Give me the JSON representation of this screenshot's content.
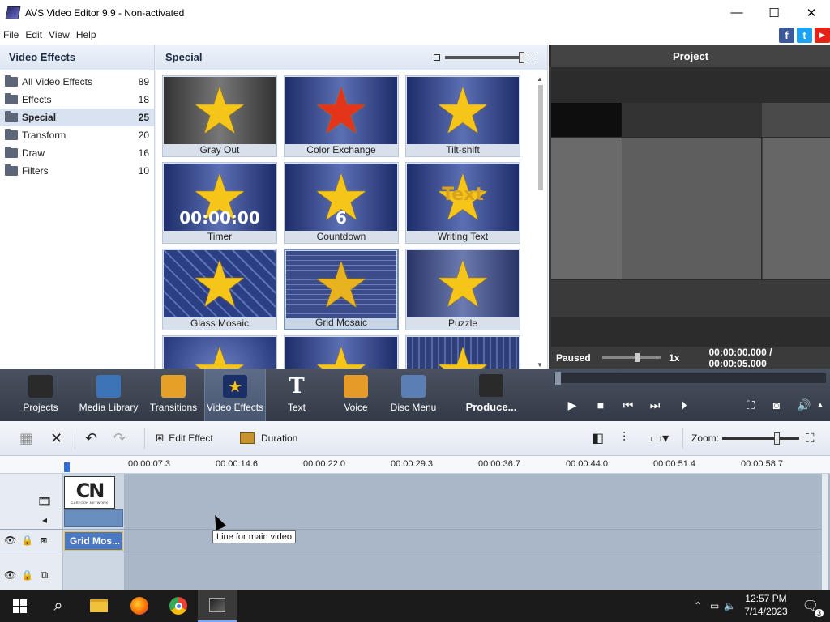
{
  "window": {
    "title": "AVS Video Editor 9.9 - Non-activated",
    "minimize": "—",
    "maximize": "☐",
    "close": "✕"
  },
  "menu": [
    "File",
    "Edit",
    "View",
    "Help"
  ],
  "social": {
    "facebook": "f",
    "twitter": "t",
    "youtube": "▶",
    "colors": {
      "facebook": "#3b5998",
      "twitter": "#1da1f2",
      "youtube": "#e62117"
    }
  },
  "categories": {
    "title": "Video Effects",
    "items": [
      {
        "label": "All Video Effects",
        "count": "89"
      },
      {
        "label": "Effects",
        "count": "18"
      },
      {
        "label": "Special",
        "count": "25",
        "selected": true
      },
      {
        "label": "Transform",
        "count": "20"
      },
      {
        "label": "Draw",
        "count": "16"
      },
      {
        "label": "Filters",
        "count": "10"
      }
    ]
  },
  "gallery": {
    "title": "Special",
    "tiles": [
      {
        "label": "Gray Out",
        "overlay": ""
      },
      {
        "label": "Color Exchange",
        "overlay": ""
      },
      {
        "label": "Tilt-shift",
        "overlay": ""
      },
      {
        "label": "Timer",
        "overlay": "00:00:00"
      },
      {
        "label": "Countdown",
        "overlay": "6"
      },
      {
        "label": "Writing Text",
        "overlay": "Text"
      },
      {
        "label": "Glass Mosaic",
        "overlay": ""
      },
      {
        "label": "Grid Mosaic",
        "overlay": "",
        "selected": true
      },
      {
        "label": "Puzzle",
        "overlay": ""
      },
      {
        "label": "",
        "overlay": ""
      },
      {
        "label": "",
        "overlay": ""
      },
      {
        "label": "",
        "overlay": ""
      }
    ]
  },
  "preview": {
    "title": "Project",
    "status": "Paused",
    "speed": "1x",
    "time": "00:00:00.000 / 00:00:05.000"
  },
  "toolbar": {
    "items": [
      {
        "label": "Projects",
        "icon": "clapper-icon"
      },
      {
        "label": "Media Library",
        "icon": "film-icon"
      },
      {
        "label": "Transitions",
        "icon": "transitions-icon"
      },
      {
        "label": "Video Effects",
        "icon": "star-icon",
        "active": true
      },
      {
        "label": "Text",
        "icon": "text-icon",
        "glyph": "T"
      },
      {
        "label": "Voice",
        "icon": "microphone-icon"
      },
      {
        "label": "Disc Menu",
        "icon": "disc-icon"
      },
      {
        "label": "Produce...",
        "icon": "produce-icon"
      }
    ]
  },
  "timeline_toolbar": {
    "edit_effect": "Edit Effect",
    "duration": "Duration",
    "zoom_label": "Zoom:"
  },
  "ruler": {
    "ticks": [
      "00:00:07.3",
      "00:00:14.6",
      "00:00:22.0",
      "00:00:29.3",
      "00:00:36.7",
      "00:00:44.0",
      "00:00:51.4",
      "00:00:58.7"
    ]
  },
  "tracks": {
    "video_clip_text": "CN",
    "video_clip_sub": "CARTOON NETWORK",
    "effect_clip": "Grid Mos...",
    "tooltip": "Line for main video"
  },
  "taskbar": {
    "time": "12:57 PM",
    "date": "7/14/2023",
    "notifications": "3"
  }
}
